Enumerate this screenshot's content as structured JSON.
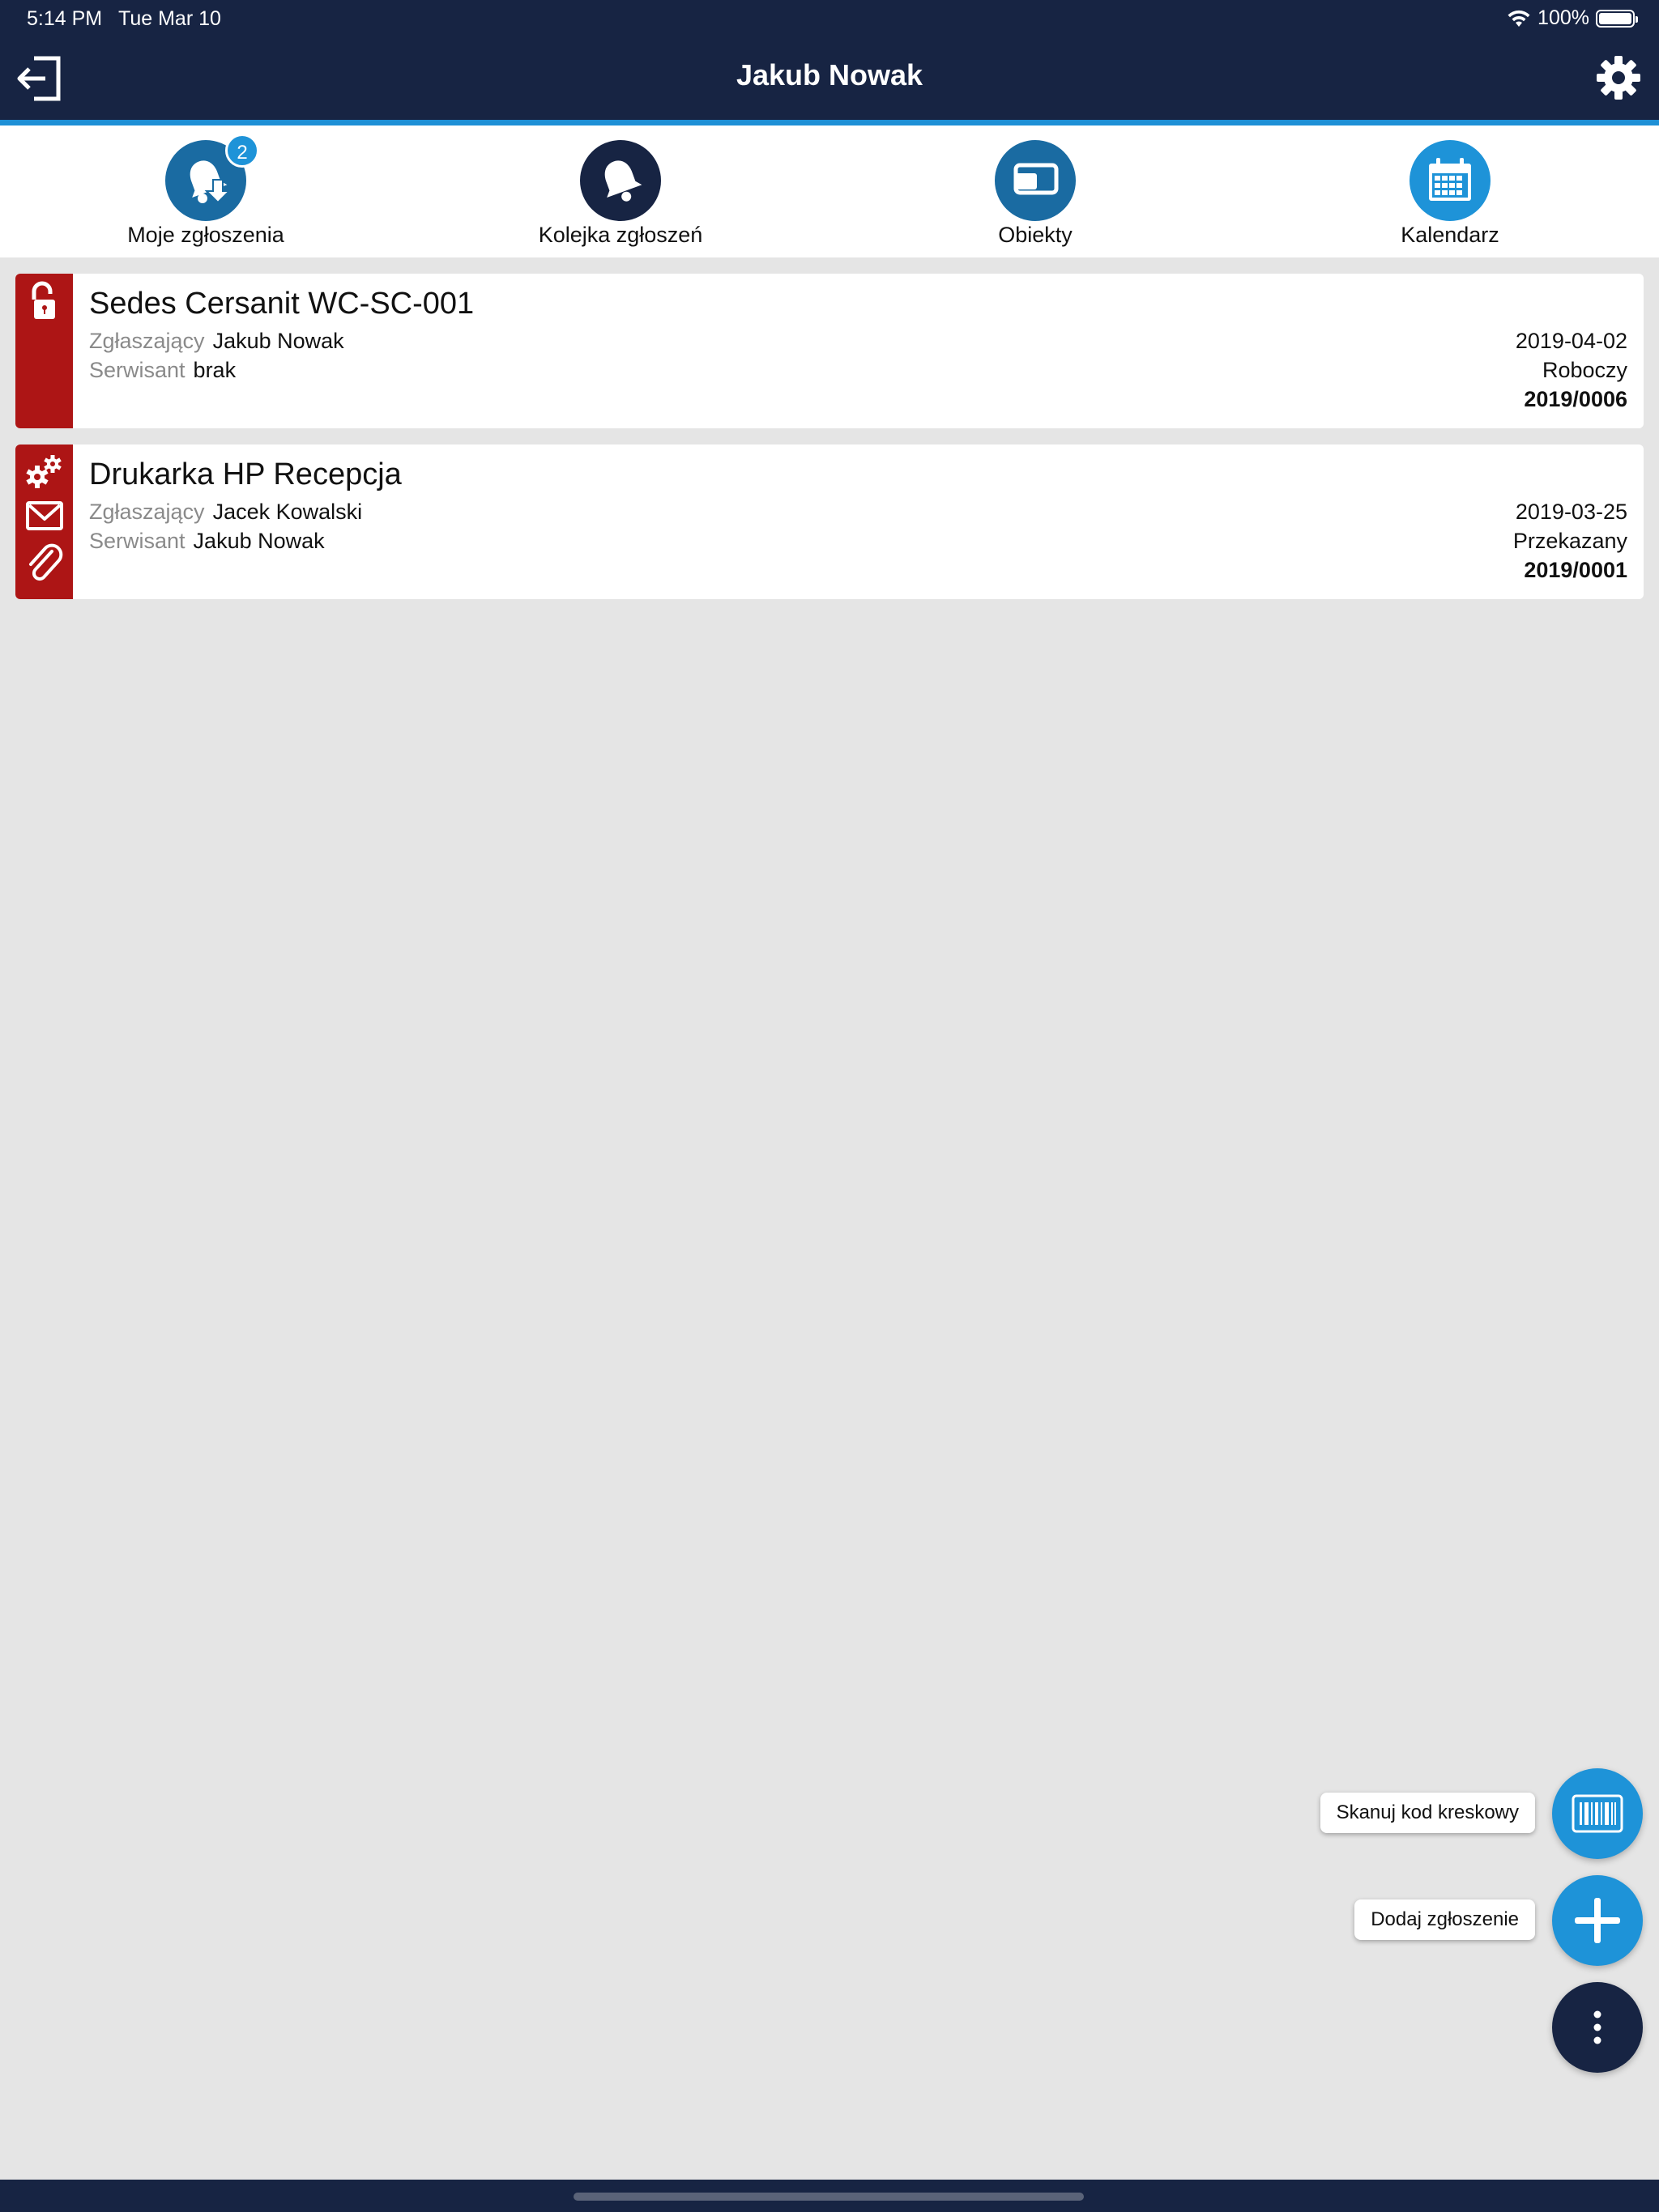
{
  "status_bar": {
    "time": "5:14 PM",
    "date": "Tue Mar 10",
    "battery": "100%"
  },
  "header": {
    "title": "Jakub Nowak",
    "logout_icon": "logout-icon",
    "settings_icon": "gear-icon"
  },
  "nav": {
    "items": [
      {
        "label": "Moje zgłoszenia",
        "icon": "bell-download-icon",
        "badge": "2",
        "color": "#1a6ba2"
      },
      {
        "label": "Kolejka zgłoszeń",
        "icon": "bell-icon",
        "color": "#172443"
      },
      {
        "label": "Obiekty",
        "icon": "devices-icon",
        "color": "#1a6ba2"
      },
      {
        "label": "Kalendarz",
        "icon": "calendar-icon",
        "color": "#1e93d8"
      }
    ]
  },
  "tickets": [
    {
      "title": "Sedes Cersanit WC-SC-001",
      "reporter_label": "Zgłaszający",
      "reporter": "Jakub Nowak",
      "technician_label": "Serwisant",
      "technician": "brak",
      "date": "2019-04-02",
      "status": "Roboczy",
      "number": "2019/0006",
      "icons": [
        "unlock-icon"
      ]
    },
    {
      "title": "Drukarka HP Recepcja",
      "reporter_label": "Zgłaszający",
      "reporter": "Jacek Kowalski",
      "technician_label": "Serwisant",
      "technician": "Jakub Nowak",
      "date": "2019-03-25",
      "status": "Przekazany",
      "number": "2019/0001",
      "icons": [
        "gears-icon",
        "mail-icon",
        "paperclip-icon"
      ]
    }
  ],
  "fab": {
    "scan_label": "Skanuj kod kreskowy",
    "add_label": "Dodaj zgłoszenie",
    "scan_icon": "barcode-icon",
    "add_icon": "plus-icon",
    "menu_icon": "more-vertical-icon"
  },
  "colors": {
    "header_bg": "#172443",
    "accent": "#1e93d8",
    "strip_red": "#ad1515",
    "background": "#e5e5e5"
  }
}
